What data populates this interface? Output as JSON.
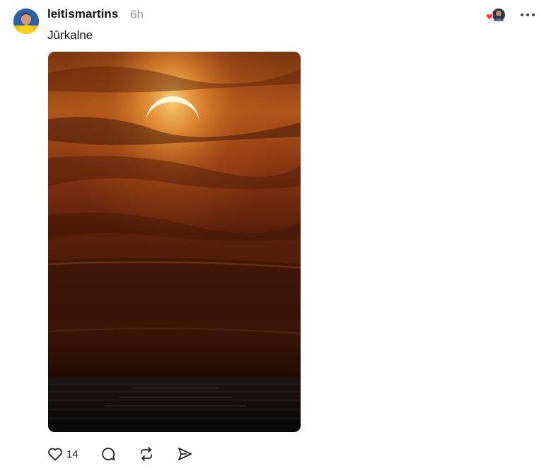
{
  "post": {
    "username": "leitismartins",
    "time_ago": "6h",
    "caption": "Jūrkalne",
    "like_count": "14"
  },
  "icons": {
    "avatar": "avatar-image",
    "liked_by": "liked-by-avatar-icon",
    "more": "more-options-icon",
    "like": "heart-icon",
    "comment": "comment-icon",
    "repost": "repost-icon",
    "share": "share-icon"
  },
  "colors": {
    "like_heart": "#ff3040",
    "secondary_text": "#999999"
  }
}
